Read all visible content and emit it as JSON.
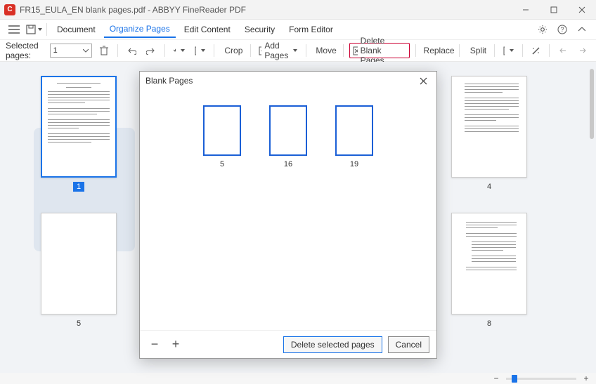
{
  "window": {
    "title": "FR15_EULA_EN blank pages.pdf - ABBYY FineReader PDF"
  },
  "menu": {
    "items": [
      "Document",
      "Organize Pages",
      "Edit Content",
      "Security",
      "Form Editor"
    ],
    "active_index": 1
  },
  "toolbar": {
    "selected_label": "Selected pages:",
    "selected_value": "1",
    "crop": "Crop",
    "add_pages": "Add Pages",
    "move": "Move",
    "delete_blank": "Delete Blank Pages",
    "replace": "Replace",
    "split": "Split"
  },
  "thumbnails": {
    "row1": [
      {
        "label": "1",
        "selected": true
      },
      {
        "label": "4",
        "selected": false
      }
    ],
    "row2": [
      {
        "label": "5",
        "selected": false
      },
      {
        "label": "8",
        "selected": false
      }
    ]
  },
  "dialog": {
    "title": "Blank Pages",
    "blank_pages": [
      "5",
      "16",
      "19"
    ],
    "primary_button": "Delete selected pages",
    "cancel_button": "Cancel"
  }
}
